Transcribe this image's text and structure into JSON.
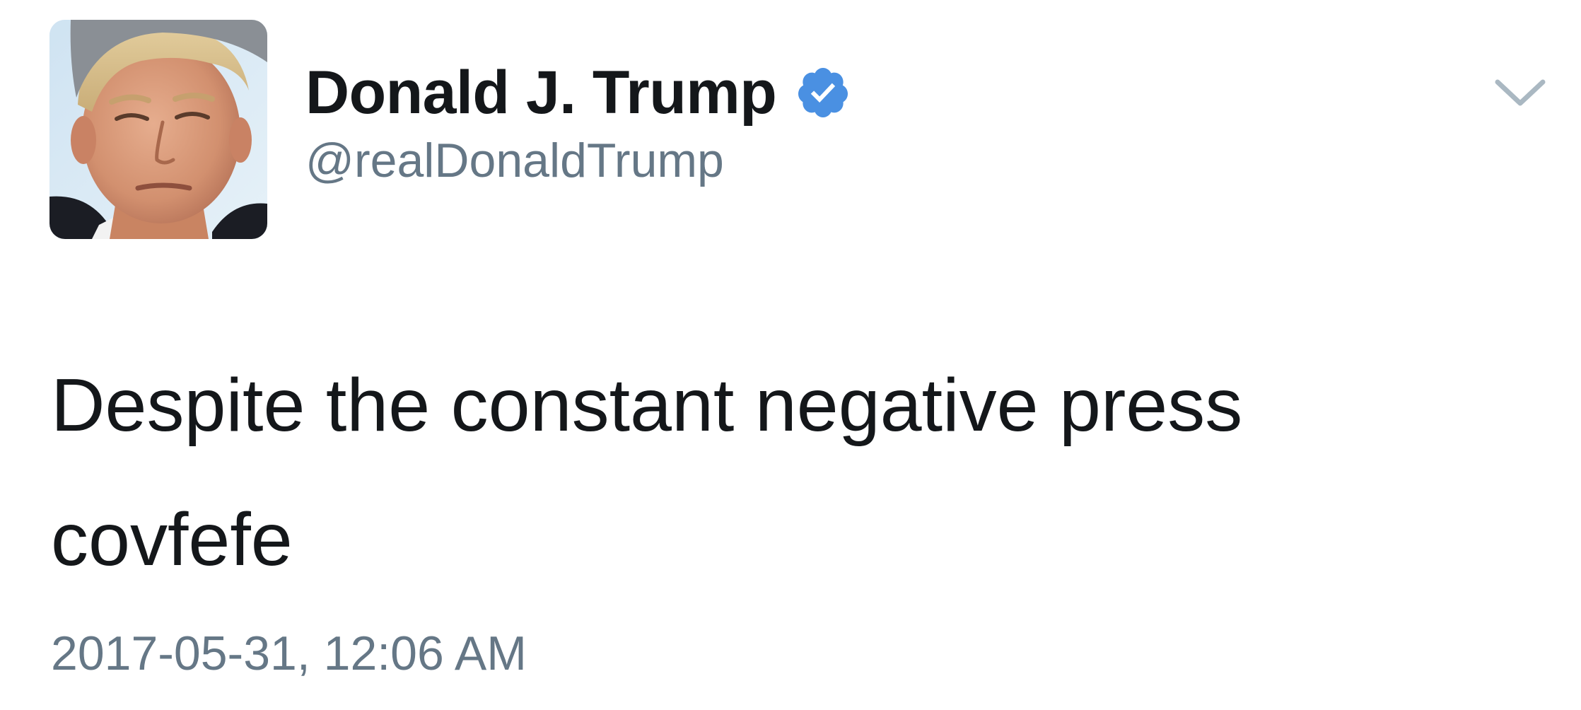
{
  "author": {
    "display_name": "Donald J. Trump",
    "handle": "@realDonaldTrump",
    "verified": true,
    "avatar_icon": "profile-photo"
  },
  "tweet": {
    "text_lines": [
      "Despite the constant negative press",
      "covfefe"
    ],
    "timestamp": "2017-05-31, 12:06 AM"
  },
  "menu": {
    "icon": "chevron-down-icon"
  },
  "colors": {
    "text": "#14171a",
    "secondary_text": "#657786",
    "verified_blue": "#4a90e2",
    "caret": "#aab8c2"
  }
}
